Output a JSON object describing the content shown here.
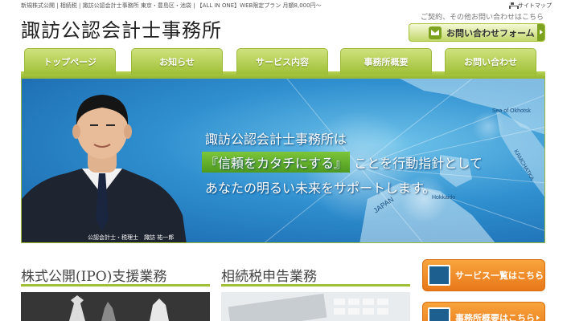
{
  "header": {
    "tagline": "新規株式公開 | 相続税 | 諏訪公認会計士事務所 東京・豊島区・池袋 | 【ALL IN ONE】WEB限定プラン 月額8,000円〜",
    "sitemap_label": "サイトマップ",
    "logo_text": "諏訪公認会計士事務所",
    "contact_note": "ご契約、その他お問い合わせはこちら",
    "contact_button_label": "お問い合わせフォーム"
  },
  "nav": {
    "items": [
      {
        "label": "トップページ"
      },
      {
        "label": "お知らせ"
      },
      {
        "label": "サービス内容"
      },
      {
        "label": "事務所概要"
      },
      {
        "label": "お問い合わせ"
      }
    ]
  },
  "hero": {
    "line1": "諏訪公認会計士事務所は",
    "highlight": "『信頼をカタチにする』",
    "line2_rest": "ことを行動指針として",
    "line3": "あなたの明るい未来をサポートします。",
    "caption": "公認会計士・税理士　諏訪 祐一郎",
    "map_labels": [
      "Sea of Okhotsk",
      "Hokkaido",
      "JAPAN",
      "KAMCHATKA"
    ]
  },
  "sections": [
    {
      "title": "株式公開(IPO)支援業務"
    },
    {
      "title": "相続税申告業務"
    }
  ],
  "side_buttons": [
    {
      "label": "サービス一覧はこちら"
    },
    {
      "label": "事務所概要はこちら"
    }
  ],
  "colors": {
    "nav_green": "#9fbf35",
    "hero_blue": "#2f8fcf",
    "orange": "#e8781a"
  }
}
